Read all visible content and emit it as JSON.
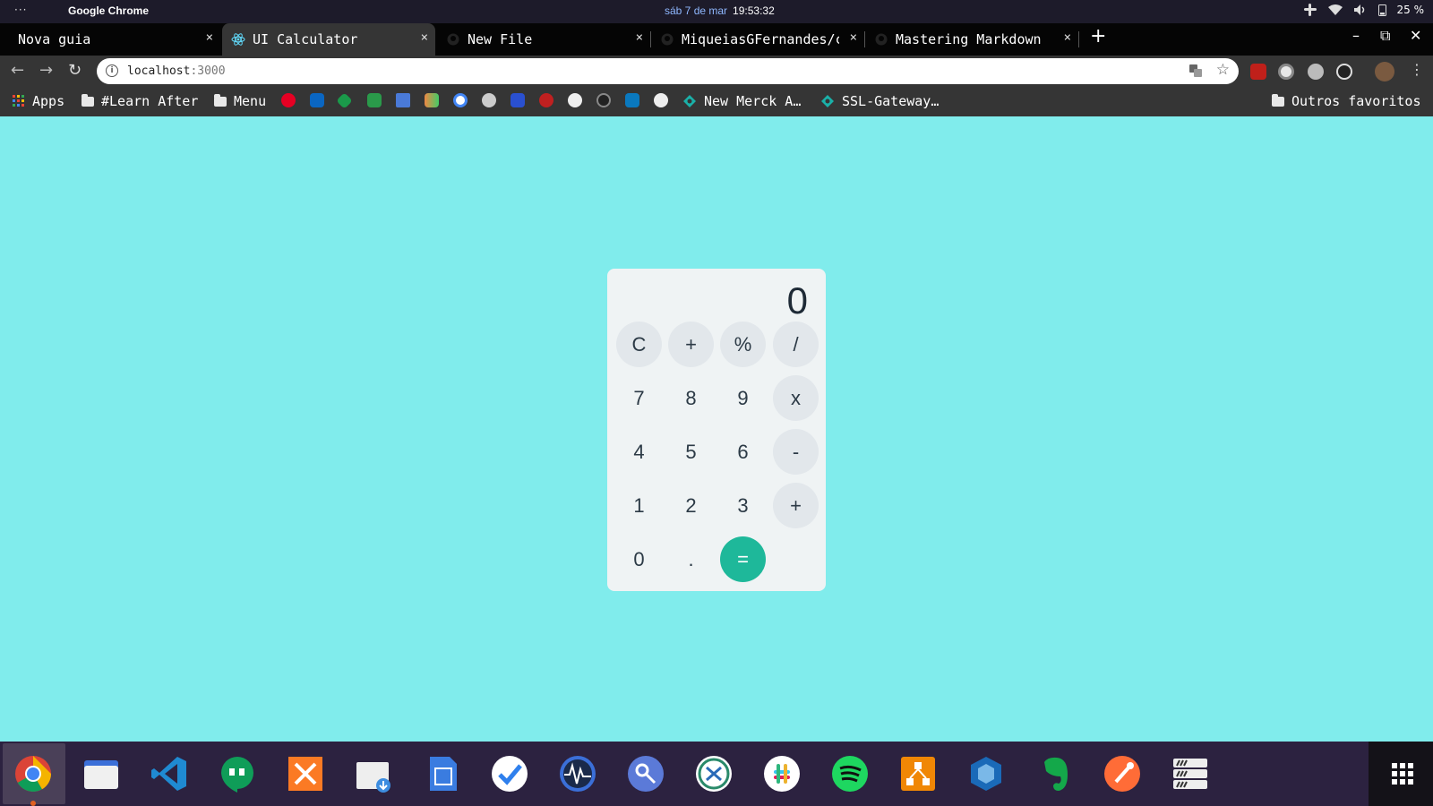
{
  "topbar": {
    "activities": "···",
    "app_name": "Google Chrome",
    "date": "sáb 7 de mar",
    "time": "19:53:32",
    "battery": "25 %"
  },
  "tabs": [
    {
      "title": "Nova guia",
      "active": false,
      "icon": "none"
    },
    {
      "title": "UI Calculator",
      "active": true,
      "icon": "react-icon"
    },
    {
      "title": "New File",
      "active": false,
      "icon": "github-icon"
    },
    {
      "title": "MiqueiasGFernandes/c",
      "active": false,
      "icon": "github-icon"
    },
    {
      "title": "Mastering Markdown",
      "active": false,
      "icon": "github-icon"
    }
  ],
  "tab_close": "×",
  "new_tab": "+",
  "window_controls": {
    "minimize": "–",
    "restore": "⧉",
    "close": "✕"
  },
  "toolbar": {
    "back": "←",
    "forward": "→",
    "reload": "↻",
    "url_host": "localhost",
    "url_port": ":3000",
    "star": "☆",
    "menu": "⋮"
  },
  "bookmarks": {
    "apps": "Apps",
    "learn_after": "#Learn After",
    "menu": "Menu",
    "new_merck": "New Merck A…",
    "ssl_gateway": "SSL-Gateway…",
    "other_bookmarks": "Outros favoritos"
  },
  "calculator": {
    "display": "0",
    "keys": {
      "clear": "C",
      "sign": "+",
      "percent": "%",
      "divide": "/",
      "seven": "7",
      "eight": "8",
      "nine": "9",
      "multiply": "x",
      "four": "4",
      "five": "5",
      "six": "6",
      "minus": "-",
      "one": "1",
      "two": "2",
      "three": "3",
      "plus": "+",
      "zero": "0",
      "decimal": ".",
      "equals": "="
    },
    "colors": {
      "background": "#80ecec",
      "panel": "#eff3f4",
      "equals": "#1eb89a"
    }
  },
  "dock": {
    "apps": [
      "chrome",
      "files",
      "vscode",
      "hangouts",
      "xampp",
      "software-install",
      "libreoffice-writer",
      "todo",
      "system-monitor",
      "passwords",
      "remmina",
      "slack",
      "spotify",
      "drawio",
      "virtualbox",
      "evernote",
      "postman",
      "servers"
    ]
  }
}
